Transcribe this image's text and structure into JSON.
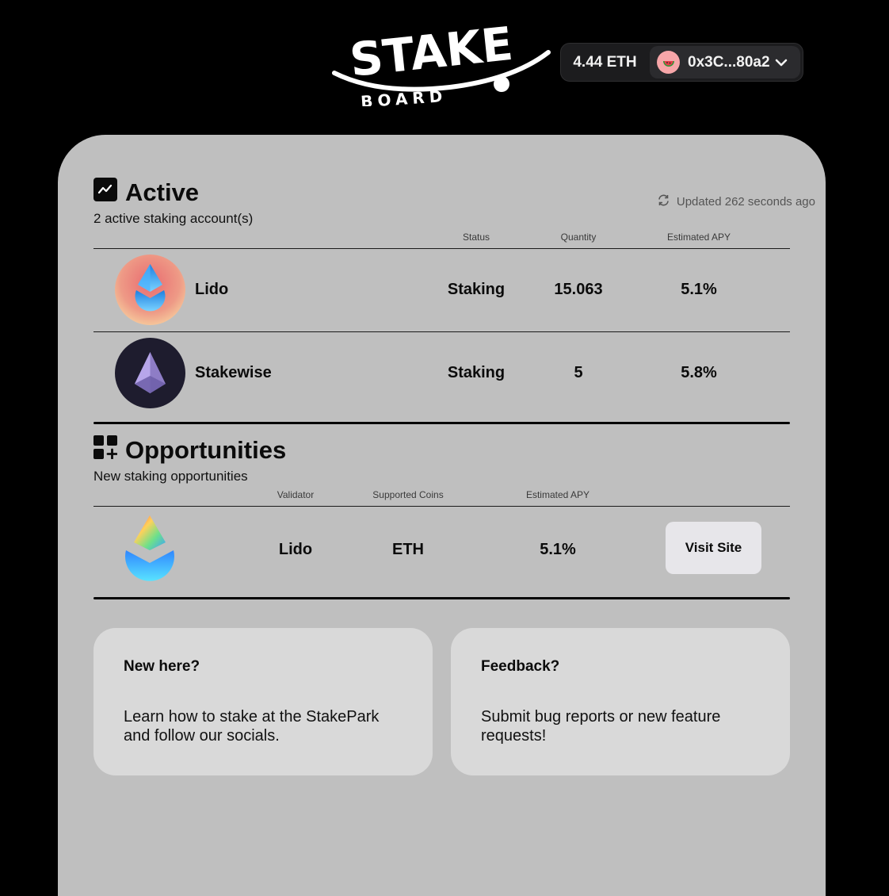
{
  "header": {
    "logo_top": "STAKE",
    "logo_bottom": "BOARD",
    "balance": "4.44 ETH",
    "address": "0x3C...80a2"
  },
  "active": {
    "title": "Active",
    "subtitle": "2 active staking account(s)",
    "updated": "Updated 262 seconds ago",
    "columns": {
      "status": "Status",
      "quantity": "Quantity",
      "apy": "Estimated APY"
    },
    "rows": [
      {
        "name": "Lido",
        "status": "Staking",
        "quantity": "15.063",
        "apy": "5.1%"
      },
      {
        "name": "Stakewise",
        "status": "Staking",
        "quantity": "5",
        "apy": "5.8%"
      }
    ]
  },
  "opportunities": {
    "title": "Opportunities",
    "subtitle": "New staking opportunities",
    "columns": {
      "validator": "Validator",
      "coins": "Supported Coins",
      "apy": "Estimated APY"
    },
    "rows": [
      {
        "validator": "Lido",
        "coins": "ETH",
        "apy": "5.1%",
        "action": "Visit Site"
      }
    ]
  },
  "cards": [
    {
      "title": "New here?",
      "body": "Learn how to stake at the StakePark and follow our socials."
    },
    {
      "title": "Feedback?",
      "body": "Submit bug reports or new feature requests!"
    }
  ],
  "colors": {
    "background": "#000000",
    "panel": "#bfbfbf",
    "card": "#d9d9d9",
    "button": "#e7e6ea"
  },
  "icons": [
    "logo",
    "chart-icon",
    "refresh-icon",
    "grid-plus-icon",
    "lido-icon",
    "stakewise-icon",
    "chevron-down-icon",
    "watermelon-icon"
  ]
}
